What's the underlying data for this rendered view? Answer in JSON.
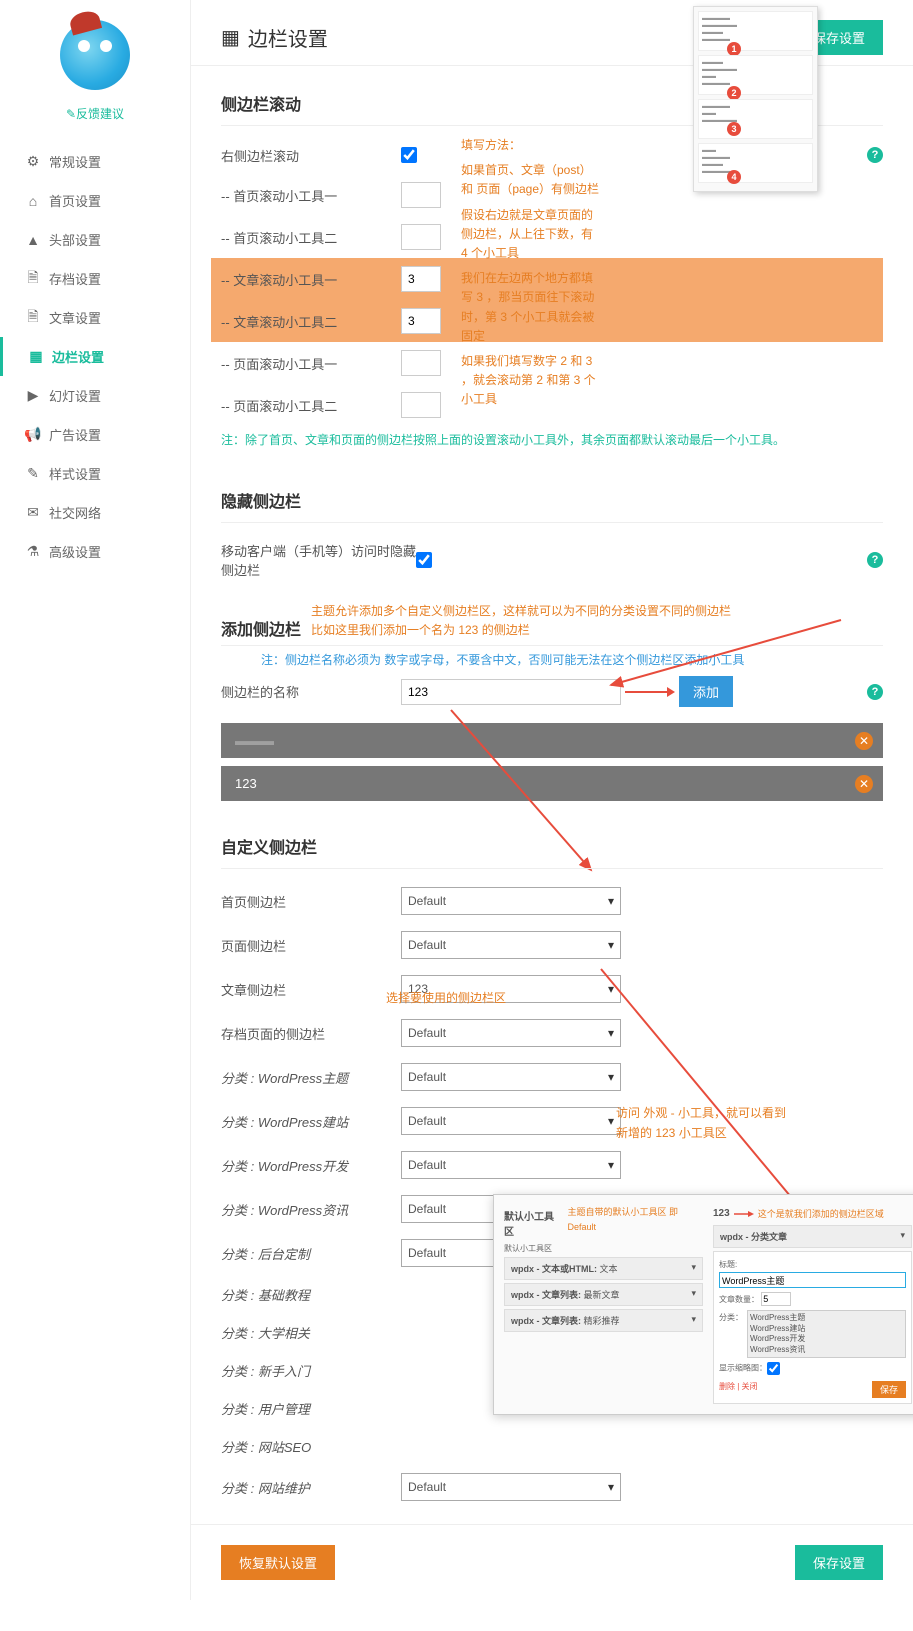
{
  "page": {
    "title": "边栏设置"
  },
  "sidebar_nav": {
    "feedback": "反馈建议",
    "items": [
      {
        "icon": "⚙",
        "label": "常规设置"
      },
      {
        "icon": "⌂",
        "label": "首页设置"
      },
      {
        "icon": "▲",
        "label": "头部设置"
      },
      {
        "icon": "🗎",
        "label": "存档设置"
      },
      {
        "icon": "🗎",
        "label": "文章设置"
      },
      {
        "icon": "▦",
        "label": "边栏设置",
        "active": true
      },
      {
        "icon": "▶",
        "label": "幻灯设置"
      },
      {
        "icon": "📢",
        "label": "广告设置"
      },
      {
        "icon": "✎",
        "label": "样式设置"
      },
      {
        "icon": "✉",
        "label": "社交网络"
      },
      {
        "icon": "⚗",
        "label": "高级设置"
      }
    ]
  },
  "buttons": {
    "save": "保存设置",
    "add": "添加",
    "restore": "恢复默认设置"
  },
  "sections": {
    "scroll": {
      "title": "侧边栏滚动",
      "right_scroll": "右侧边栏滚动",
      "home1": "-- 首页滚动小工具一",
      "home2": "-- 首页滚动小工具二",
      "post1": "-- 文章滚动小工具一",
      "post1_val": "3",
      "post2": "-- 文章滚动小工具二",
      "post2_val": "3",
      "page1": "-- 页面滚动小工具一",
      "page2": "-- 页面滚动小工具二",
      "note": "注：除了首页、文章和页面的侧边栏按照上面的设置滚动小工具外，其余页面都默认滚动最后一个小工具。"
    },
    "scroll_annotation": {
      "l1": "填写方法：",
      "l2": "如果首页、文章（post）和 页面（page）有侧边栏",
      "l3": "假设右边就是文章页面的侧边栏，从上往下数，有 4 个小工具",
      "l4": "我们在左边两个地方都填写 3 ，那当页面往下滚动时，第 3 个小工具就会被固定",
      "l5": "如果我们填写数字 2 和 3 ，就会滚动第 2 和第 3 个小工具"
    },
    "hide": {
      "title": "隐藏侧边栏",
      "mobile": "移动客户端（手机等）访问时隐藏侧边栏"
    },
    "add": {
      "title": "添加侧边栏",
      "hint1": "主题允许添加多个自定义侧边栏区，这样就可以为不同的分类设置不同的侧边栏",
      "hint2": "比如这里我们添加一个名为 123 的侧边栏",
      "note": "注：侧边栏名称必须为 数字或字母，不要含中文，否则可能无法在这个侧边栏区添加小工具",
      "name_label": "侧边栏的名称",
      "name_value": "123",
      "bar1": "",
      "bar2": "123"
    },
    "custom": {
      "title": "自定义侧边栏",
      "select_hint": "选择要使用的侧边栏区",
      "visit_hint": "访问 外观 - 小工具，就可以看到新增的 123 小工具区",
      "rows": [
        {
          "label": "首页侧边栏",
          "value": "Default"
        },
        {
          "label": "页面侧边栏",
          "value": "Default"
        },
        {
          "label": "文章侧边栏",
          "value": "123"
        },
        {
          "label": "存档页面的侧边栏",
          "value": "Default"
        },
        {
          "label": "分类 : WordPress主题",
          "value": "Default",
          "italic": true
        },
        {
          "label": "分类 : WordPress建站",
          "value": "Default",
          "italic": true
        },
        {
          "label": "分类 : WordPress开发",
          "value": "Default",
          "italic": true
        },
        {
          "label": "分类 : WordPress资讯",
          "value": "Default",
          "italic": true
        },
        {
          "label": "分类 : 后台定制",
          "value": "Default",
          "italic": true
        },
        {
          "label": "分类 : 基础教程",
          "value": "",
          "italic": true
        },
        {
          "label": "分类 : 大学相关",
          "value": "",
          "italic": true
        },
        {
          "label": "分类 : 新手入门",
          "value": "",
          "italic": true
        },
        {
          "label": "分类 : 用户管理",
          "value": "",
          "italic": true
        },
        {
          "label": "分类 : 网站SEO",
          "value": "",
          "italic": true
        },
        {
          "label": "分类 : 网站维护",
          "value": "Default",
          "italic": true
        }
      ]
    }
  },
  "widget_preview": {
    "left_title": "默认小工具区",
    "left_note": "主题自带的默认小工具区 即 Default",
    "left_sub": "默认小工具区",
    "left_items": [
      {
        "n": "wpdx - 文本或HTML:",
        "d": "文本"
      },
      {
        "n": "wpdx - 文章列表:",
        "d": "最新文章"
      },
      {
        "n": "wpdx - 文章列表:",
        "d": "精彩推荐"
      }
    ],
    "right_title": "123",
    "right_note": "这个是就我们添加的侧边栏区域",
    "right_widget": "wpdx - 分类文章",
    "right_label_title": "标题:",
    "right_val_title": "WordPress主题",
    "right_label_count": "文章数量：",
    "right_val_count": "5",
    "right_label_cat": "分类：",
    "right_cats": "WordPress主题\nWordPress建站\nWordPress开发\nWordPress资讯",
    "right_thumb": "显示缩略图：",
    "right_del": "删除 | 关闭",
    "right_save": "保存"
  }
}
